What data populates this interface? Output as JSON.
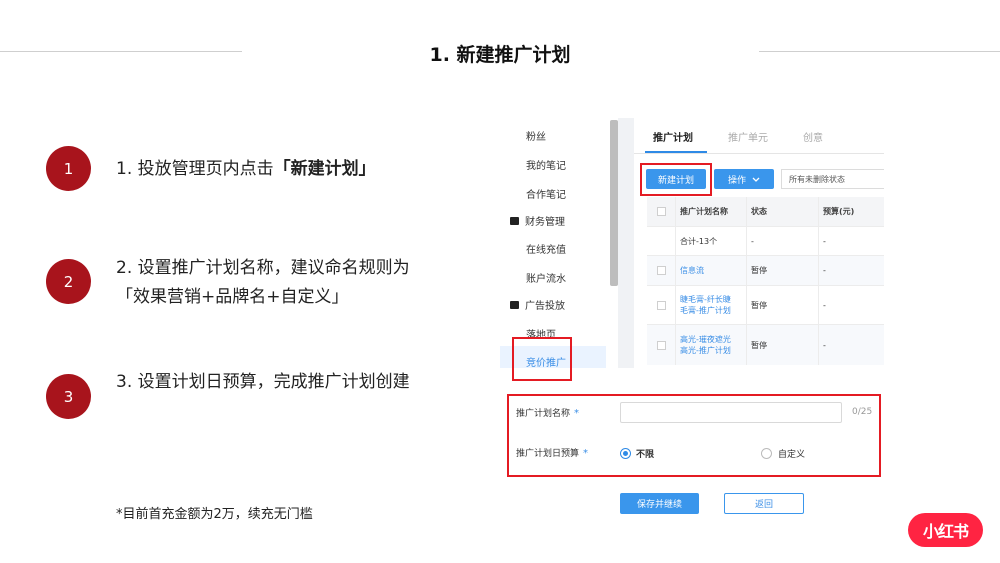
{
  "slide": {
    "title": "1. 新建推广计划",
    "steps": [
      {
        "number": "1",
        "text_prefix": "1. 投放管理页内点击",
        "text_bold": "「新建计划」"
      },
      {
        "number": "2",
        "line1": "2. 设置推广计划名称，建议命名规则为",
        "line2": "「效果营销+品牌名+自定义」"
      },
      {
        "number": "3",
        "text": "3. 设置计划日预算，完成推广计划创建"
      }
    ],
    "footnote": "*目前首充金额为2万，续充无门槛",
    "logo_text": "小红书",
    "accent_color": "#a8141c",
    "highlight_color": "#e41b23"
  },
  "app": {
    "sidebar": {
      "items": [
        "粉丝",
        "我的笔记",
        "合作笔记",
        "财务管理",
        "在线充值",
        "账户流水",
        "广告投放",
        "落地页",
        "竞价推广"
      ],
      "active": "竞价推广"
    },
    "tabs": [
      "推广计划",
      "推广单元",
      "创意"
    ],
    "active_tab": "推广计划",
    "toolbar": {
      "new_plan": "新建计划",
      "operate": "操作",
      "filter_value": "所有未删除状态"
    },
    "table": {
      "headers": [
        "推广计划名称",
        "状态",
        "预算(元)"
      ],
      "summary": {
        "name": "合计-13个",
        "status": "-",
        "budget": "-"
      },
      "rows": [
        {
          "name_line1": "信息流",
          "name_line2": "",
          "status": "暂停",
          "budget": "-"
        },
        {
          "name_line1": "睫毛膏-纤长睫",
          "name_line2": "毛膏-推广计划",
          "status": "暂停",
          "budget": "-"
        },
        {
          "name_line1": "高光-璀夜遮光",
          "name_line2": "高光-推广计划",
          "status": "暂停",
          "budget": "-"
        }
      ]
    },
    "form": {
      "name_label": "推广计划名称",
      "name_value": "",
      "name_counter": "0/25",
      "budget_label": "推广计划日预算",
      "required_mark": "*",
      "options": [
        "不限",
        "自定义"
      ],
      "selected_option": "不限",
      "save_button": "保存并继续",
      "back_button": "返回"
    },
    "primary_color": "#3a96ec"
  }
}
